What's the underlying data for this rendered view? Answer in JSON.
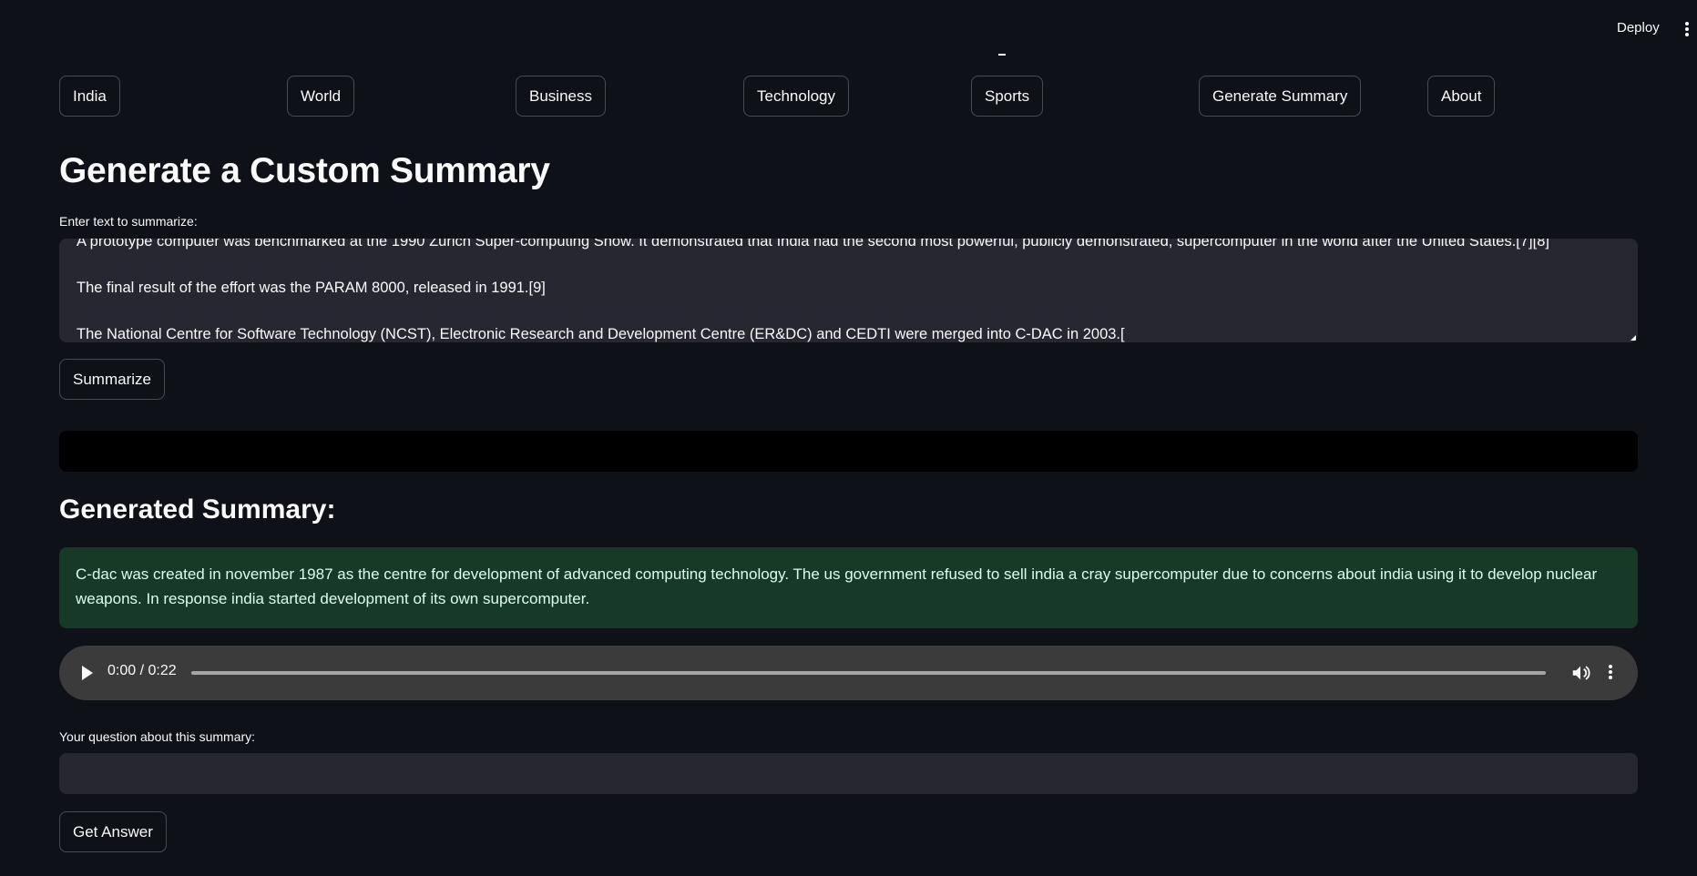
{
  "header": {
    "deploy_label": "Deploy"
  },
  "nav": {
    "items": [
      "India",
      "World",
      "Business",
      "Technology",
      "Sports",
      "Generate Summary",
      "About"
    ]
  },
  "page": {
    "title": "Generate a Custom Summary",
    "input_label": "Enter text to summarize:",
    "input_lines": [
      "A prototype computer was benchmarked at the 1990 Zurich Super-computing Show. It demonstrated that India had the second most powerful, publicly demonstrated, supercomputer in the world after the United States.[7][8]",
      "The final result of the effort was the PARAM 8000, released in 1991.[9]",
      "The National Centre for Software Technology (NCST), Electronic Research and Development Centre (ER&DC) and CEDTI were merged into C-DAC in 2003.["
    ],
    "summarize_label": "Summarize",
    "summary_header": "Generated Summary:",
    "summary_text": "C-dac was created in november 1987 as the centre for development of advanced computing technology. The us government refused to sell india a cray supercomputer due to concerns about india using it to develop nuclear weapons. In response india started development of its own supercomputer.",
    "audio": {
      "time": "0:00 / 0:22",
      "progress": 0
    },
    "question_label": "Your question about this summary:",
    "question_value": "",
    "answer_label": "Get Answer"
  },
  "colors": {
    "background": "#0e1117",
    "input_bg": "#262730",
    "success_bg": "#173928",
    "audio_bg": "#3b3b3b"
  }
}
